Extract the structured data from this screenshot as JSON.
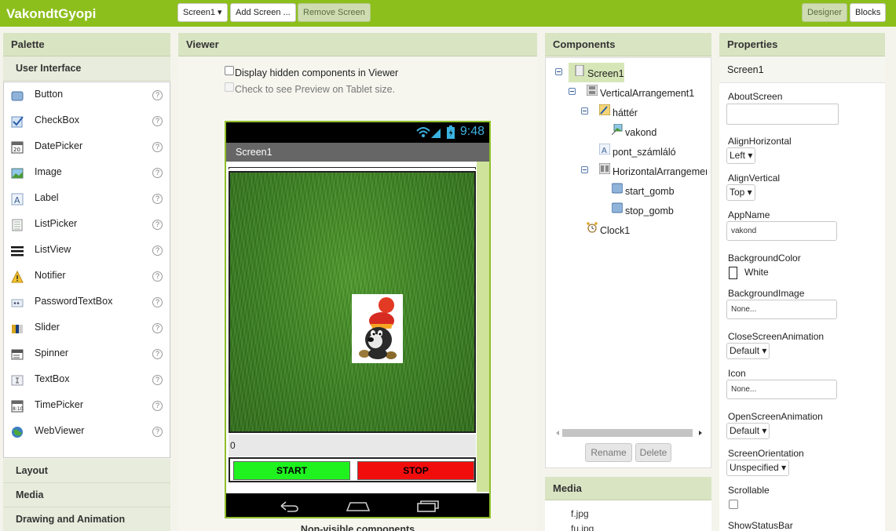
{
  "app": {
    "title": "VakondtGyopi"
  },
  "toolbar": {
    "screen_select": "Screen1 ▾",
    "add_screen": "Add Screen ...",
    "remove_screen": "Remove Screen",
    "designer": "Designer",
    "blocks": "Blocks"
  },
  "palette": {
    "title": "Palette",
    "category_open": "User Interface",
    "items": [
      {
        "label": "Button",
        "icon": "button-icon"
      },
      {
        "label": "CheckBox",
        "icon": "checkbox-icon"
      },
      {
        "label": "DatePicker",
        "icon": "datepicker-icon"
      },
      {
        "label": "Image",
        "icon": "image-icon"
      },
      {
        "label": "Label",
        "icon": "label-icon"
      },
      {
        "label": "ListPicker",
        "icon": "listpicker-icon"
      },
      {
        "label": "ListView",
        "icon": "listview-icon"
      },
      {
        "label": "Notifier",
        "icon": "notifier-icon"
      },
      {
        "label": "PasswordTextBox",
        "icon": "password-icon"
      },
      {
        "label": "Slider",
        "icon": "slider-icon"
      },
      {
        "label": "Spinner",
        "icon": "spinner-icon"
      },
      {
        "label": "TextBox",
        "icon": "textbox-icon"
      },
      {
        "label": "TimePicker",
        "icon": "timepicker-icon"
      },
      {
        "label": "WebViewer",
        "icon": "webviewer-icon"
      }
    ],
    "help_glyph": "?",
    "categories": [
      "Layout",
      "Media",
      "Drawing and Animation"
    ]
  },
  "viewer": {
    "title": "Viewer",
    "display_hidden": "Display hidden components in Viewer",
    "tablet_preview": "Check to see Preview on Tablet size.",
    "phone": {
      "time": "9:48",
      "screen_title": "Screen1",
      "counter": "0",
      "start_label": "START",
      "stop_label": "STOP"
    },
    "non_visible": "Non-visible components"
  },
  "components": {
    "title": "Components",
    "tree": {
      "screen": "Screen1",
      "vertical": "VerticalArrangement1",
      "hatter": "háttér",
      "vakond": "vakond",
      "pont": "pont_számláló",
      "horizontal": "HorizontalArrangemen",
      "start": "start_gomb",
      "stop": "stop_gomb",
      "clock": "Clock1"
    },
    "rename": "Rename",
    "delete": "Delete"
  },
  "media": {
    "title": "Media",
    "files": [
      "f.jpg",
      "fu.jpg"
    ]
  },
  "properties": {
    "title": "Properties",
    "component": "Screen1",
    "about_screen": "AboutScreen",
    "align_horizontal": "AlignHorizontal",
    "align_horizontal_value": "Left ▾",
    "align_vertical": "AlignVertical",
    "align_vertical_value": "Top ▾",
    "app_name": "AppName",
    "app_name_value": "vakond",
    "background_color": "BackgroundColor",
    "background_color_value": "White",
    "background_image": "BackgroundImage",
    "background_image_value": "None...",
    "close_anim": "CloseScreenAnimation",
    "close_anim_value": "Default ▾",
    "icon": "Icon",
    "icon_value": "None...",
    "open_anim": "OpenScreenAnimation",
    "open_anim_value": "Default ▾",
    "orientation": "ScreenOrientation",
    "orientation_value": "Unspecified ▾",
    "scrollable": "Scrollable",
    "show_status_bar": "ShowStatusBar"
  },
  "colors": {
    "topbar": "#8dbf1c",
    "start": "#1ff21f",
    "stop": "#f20d0d"
  }
}
